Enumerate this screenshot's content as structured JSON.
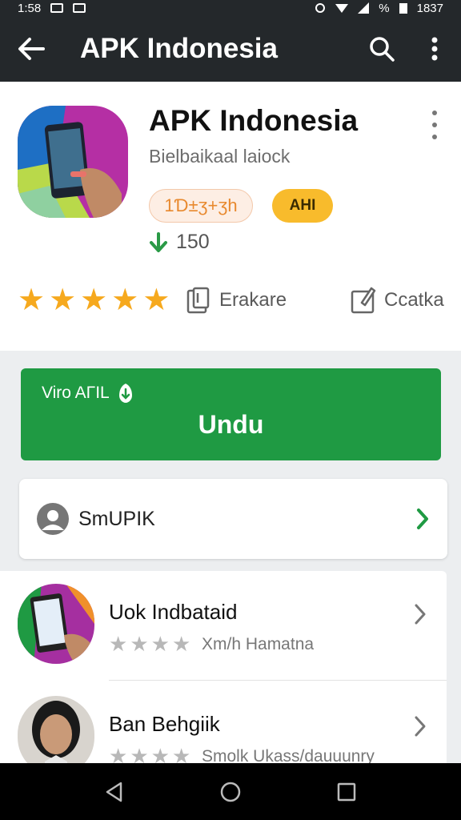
{
  "status_bar": {
    "left_time": "1:58",
    "right_time": "1837",
    "battery_text": "%"
  },
  "app_bar": {
    "title": "APK Indonesia",
    "back_icon": "arrow-left-icon",
    "search_icon": "search-icon",
    "more_icon": "more-vertical-icon"
  },
  "app": {
    "name": "APK Indonesia",
    "subtitle": "Bielbaikaal laiock",
    "tag_badge": "1Ɗ±ʒ+ʒh",
    "secondary_badge": "AHI",
    "downloads": "150",
    "rating_stars": 5,
    "meta": [
      {
        "label": "Erakare",
        "icon": "clipboard-icon"
      },
      {
        "label": "Ccatka",
        "icon": "edit-icon"
      }
    ]
  },
  "cta": {
    "top_label": "Viro AΓIL",
    "main_label": "Undu"
  },
  "profile_row": {
    "label": "SmUPIK",
    "icon": "user-circle-icon"
  },
  "list": {
    "items": [
      {
        "title": "Uok Indbataid",
        "subtitle": "Xm/h Hamatna",
        "stars": 4
      },
      {
        "title": "Ban Behgiik",
        "subtitle": "Smolk Ukass/dauuunry",
        "stars": 4
      }
    ]
  },
  "colors": {
    "app_bar": "#24282b",
    "cta_green": "#1f9a43",
    "star_gold": "#f6a91e",
    "badge_yellow": "#f8bb2c"
  }
}
